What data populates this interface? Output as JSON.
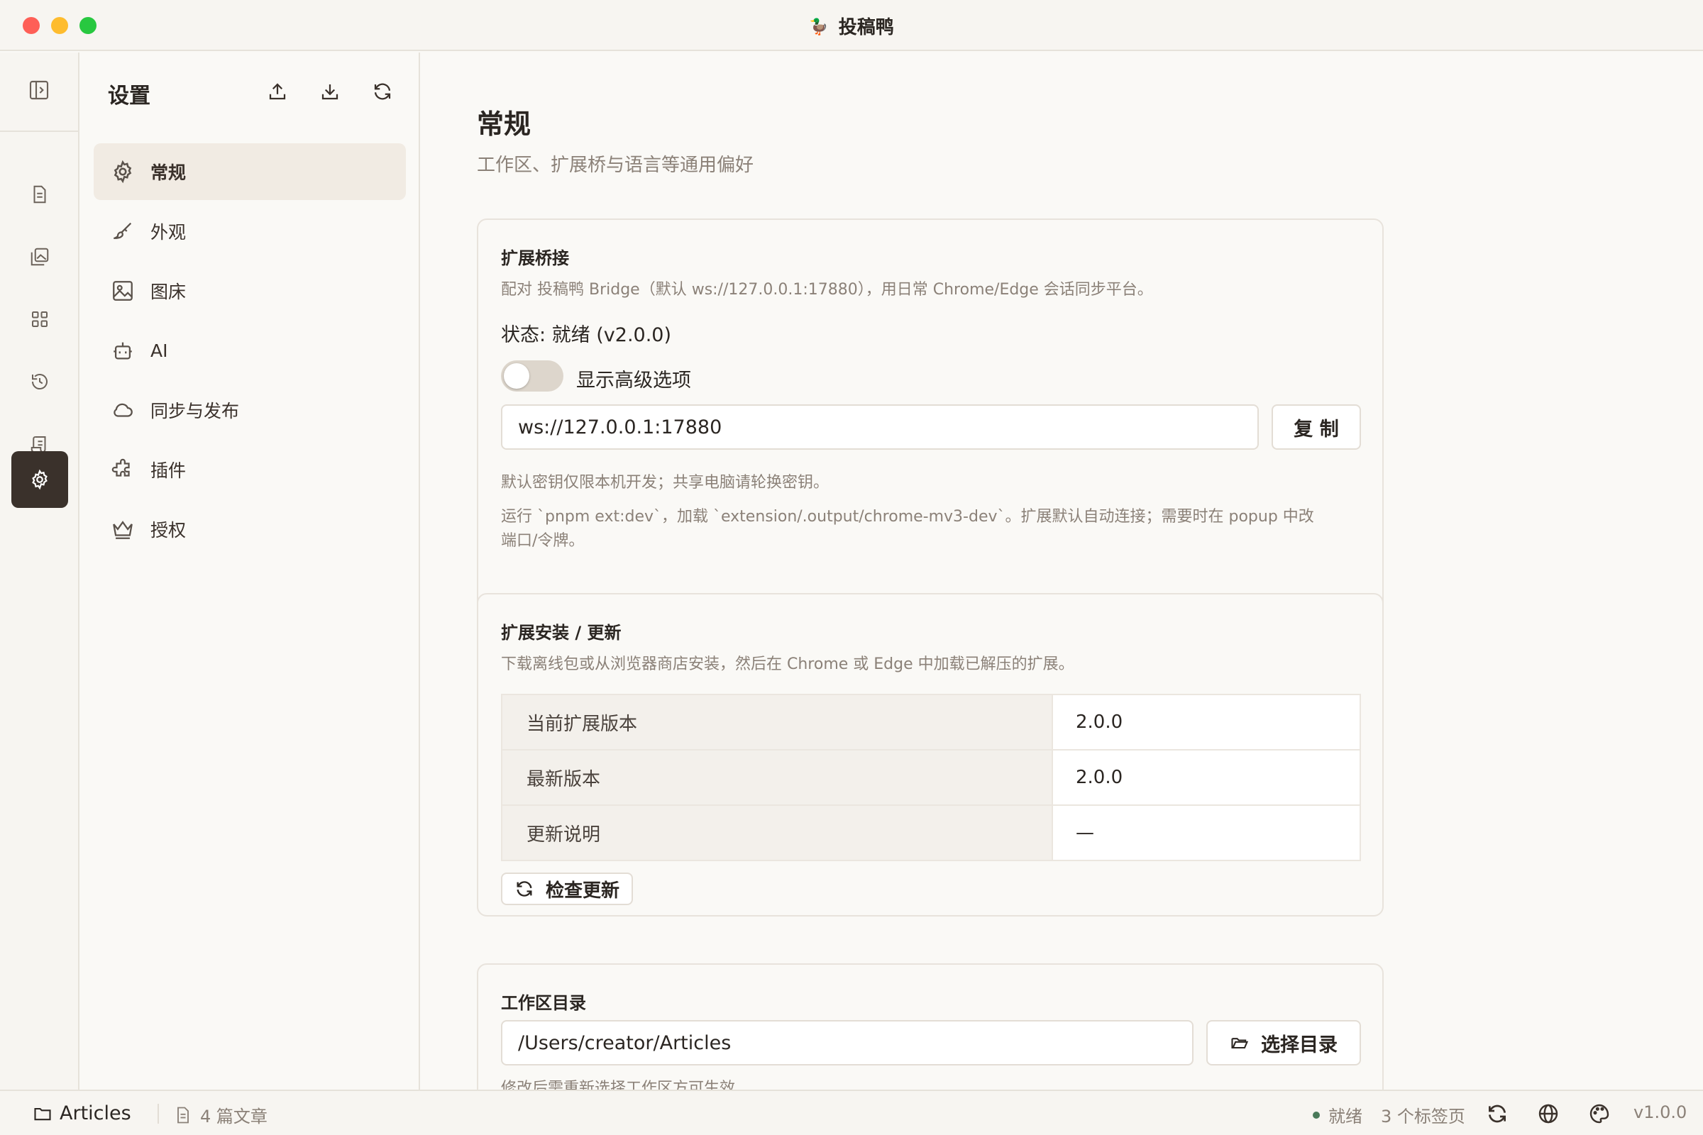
{
  "window": {
    "title": "投稿鸭",
    "title_icon": "duck-icon"
  },
  "sidebar": {
    "header": "设置",
    "actions": [
      "export-icon",
      "import-icon",
      "refresh-icon"
    ],
    "items": [
      {
        "label": "常规",
        "icon": "gear-icon",
        "active": true
      },
      {
        "label": "外观",
        "icon": "brush-icon"
      },
      {
        "label": "图床",
        "icon": "image-icon"
      },
      {
        "label": "AI",
        "icon": "robot-icon"
      },
      {
        "label": "同步与发布",
        "icon": "cloud-icon"
      },
      {
        "label": "插件",
        "icon": "puzzle-icon"
      },
      {
        "label": "授权",
        "icon": "crown-icon"
      }
    ]
  },
  "main": {
    "title": "常规",
    "subtitle": "工作区、扩展桥与语言等通用偏好",
    "bridge": {
      "title": "扩展桥接",
      "desc": "配对 投稿鸭 Bridge（默认 ws://127.0.0.1:17880），用日常 Chrome/Edge 会话同步平台。",
      "status": "状态: 就绪 (v2.0.0)",
      "advanced_label": "显示高级选项",
      "advanced_on": false,
      "url": "ws://127.0.0.1:17880",
      "copy_label": "复 制",
      "note1": "默认密钥仅限本机开发；共享电脑请轮换密钥。",
      "note2a": "运行 `pnpm ext:dev`，加载 `extension/.output/chrome-mv3-dev`。扩展默认自动连接；需要时在 popup 中改",
      "note2b": "端口/令牌。"
    },
    "install": {
      "title": "扩展安装 / 更新",
      "desc": "下载离线包或从浏览器商店安装，然后在 Chrome 或 Edge 中加载已解压的扩展。",
      "rows": [
        {
          "key": "当前扩展版本",
          "value": "2.0.0"
        },
        {
          "key": "最新版本",
          "value": "2.0.0"
        },
        {
          "key": "更新说明",
          "value": "—"
        }
      ],
      "check_label": "检查更新"
    },
    "workspace": {
      "title": "工作区目录",
      "path": "/Users/creator/Articles",
      "choose_label": "选择目录",
      "note": "修改后需重新选择工作区方可生效"
    }
  },
  "statusbar": {
    "folder": "Articles",
    "articles": "4 篇文章",
    "state": "就绪",
    "tabs": "3 个标签页",
    "version": "v1.0.0",
    "ready_color": "#4a7a5a"
  }
}
